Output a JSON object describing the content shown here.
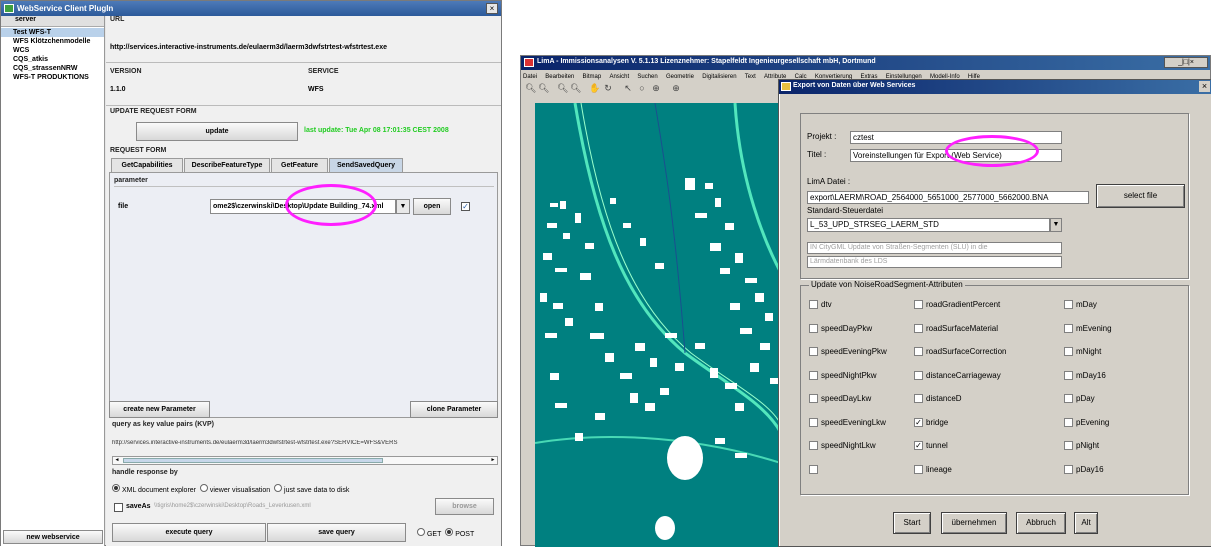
{
  "left_window": {
    "title": "WebService Client PlugIn",
    "sidebar": {
      "header": "server",
      "items": [
        "Test WFS-T",
        "WFS Klötzchenmodelle",
        "WCS",
        "CQS_atkis",
        "CQS_strassenNRW",
        "WFS-T PRODUKTIONS"
      ],
      "new_button": "new webservice"
    },
    "url_label": "URL",
    "url_value": "http://services.interactive-instruments.de/eulaerm3d/laerm3dwfstrtest-wfstrtest.exe",
    "version_label": "VERSION",
    "version_value": "1.1.0",
    "service_label": "SERVICE",
    "service_value": "WFS",
    "update_label": "UPDATE REQUEST FORM",
    "update_button": "update",
    "last_update": "last update: Tue Apr 08 17:01:35 CEST 2008",
    "request_label": "REQUEST FORM",
    "tabs": [
      "GetCapabilities",
      "DescribeFeatureType",
      "GetFeature",
      "SendSavedQuery"
    ],
    "parameter_label": "parameter",
    "file_label": "file",
    "file_value": "ome2$\\czerwinski\\Desktop\\Update Building_74",
    "file_value_suffix": ".xml",
    "open_button": "open",
    "create_param_button": "create new Parameter",
    "clone_param_button": "clone Parameter",
    "kvp_label": "query as key value pairs (KVP)",
    "kvp_value": "http://services.interactive-instruments.de/eulaerm3d/laerm3dwfstrtest-wfstrtest.exe?SERVICE=WFS&VERS",
    "handle_label": "handle response by",
    "radios": [
      "XML document explorer",
      "viewer visualisation",
      "just save data to disk"
    ],
    "saveas_label": "saveAs",
    "saveas_value": "\\\\tigris\\home2$\\czerwinski\\Desktop\\Roads_Leverkusen.xml",
    "browse_button": "browse",
    "execute_button": "execute query",
    "save_button": "save query",
    "get_label": "GET",
    "post_label": "POST",
    "close_glyph": "×",
    "dropdown_glyph": "▼",
    "check_glyph": "✓",
    "scroll_left": "◄",
    "scroll_right": "►"
  },
  "right_window": {
    "title": "LimA - Immissionsanalysen   V. 5.1.13  Lizenznehmer: Stapelfeldt Ingenieurgesellschaft mbH, Dortmund",
    "menu": [
      "Datei",
      "Bearbeiten",
      "Bitmap",
      "Ansicht",
      "Suchen",
      "Geometrie",
      "Digitalisieren",
      "Text",
      "Attribute",
      "Calc",
      "Konvertierung",
      "Extras",
      "Einstellungen",
      "Modell-Info",
      "Hilfe"
    ],
    "window_buttons": "_|□|×",
    "dialog": {
      "title": "Export von Daten über Web Services",
      "close_glyph": "×",
      "projekt_label": "Projekt :",
      "projekt_value": "cztest",
      "titel_label": "Titel     :",
      "titel_value": "Voreinstellungen für Export (Web Service)",
      "lima_label": "LimA Datei :",
      "lima_value": "export\\LAERM\\ROAD_2564000_5651000_2577000_5662000.BNA",
      "select_file_button": "select file",
      "steuer_label": "Standard-Steuerdatei",
      "steuer_value": "L_53_UPD_STRSEG_LAERM_STD",
      "info_line1": "IN CityGML Update von Straßen-Segmenten (SLU)   in die",
      "info_line2": "Lärmdatenbank des LDS",
      "group_label": "Update von NoiseRoadSegment-Attributen",
      "check_glyph": "✓",
      "attributes": [
        [
          "dtv",
          "roadGradientPercent",
          "mDay"
        ],
        [
          "speedDayPkw",
          "roadSurfaceMaterial",
          "mEvening"
        ],
        [
          "speedEveningPkw",
          "roadSurfaceCorrection",
          "mNight"
        ],
        [
          "speedNightPkw",
          "distanceCarriageway",
          "mDay16"
        ],
        [
          "speedDayLkw",
          "distanceD",
          "pDay"
        ],
        [
          "speedEveningLkw",
          "bridge",
          "pEvening"
        ],
        [
          "speedNightLkw",
          "tunnel",
          "pNight"
        ],
        [
          "",
          "lineage",
          "pDay16"
        ]
      ],
      "checked": [
        "bridge",
        "tunnel"
      ],
      "buttons": [
        "Start",
        "übernehmen",
        "Abbruch",
        "Alt"
      ]
    }
  },
  "colors": {
    "highlight": "#ff1fff",
    "map_bg": "#008080",
    "title_blue": "#0a246a",
    "green_text": "#22cc22"
  }
}
